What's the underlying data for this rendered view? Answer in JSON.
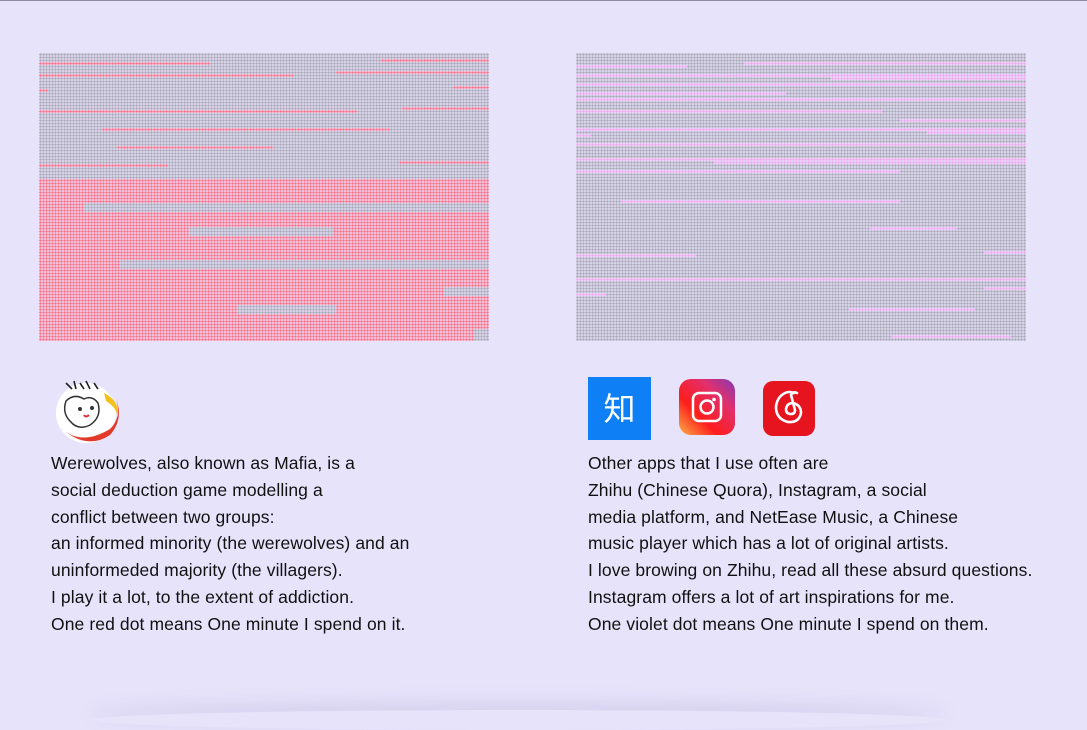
{
  "colors": {
    "background": "#e7e3fb",
    "dot_inactive": "#aba8b8",
    "dot_werewolves": "#ff6e85",
    "dot_other_apps": "#f1a6ee",
    "zhihu_blue": "#0f7ff5",
    "netease_red": "#e6141e"
  },
  "icons": {
    "left": [
      "werewolves-game-logo"
    ],
    "right": [
      "zhihu-icon",
      "instagram-icon",
      "netease-music-icon"
    ],
    "zhihu_glyph": "知"
  },
  "left": {
    "lines": [
      "Werewolves, also known as Mafia, is a",
      "social deduction game modelling a",
      "conflict between two groups:",
      "an informed minority (the werewolves) and an",
      "uninformeded majority (the villagers).",
      "I play it a lot, to the extent of addiction.",
      "One red dot means One minute I spend on it."
    ]
  },
  "right": {
    "lines": [
      "Other apps that I use often are",
      "Zhihu (Chinese Quora), Instagram, a social",
      "media platform, and NetEase Music, a Chinese",
      "music player which has a lot of original artists.",
      "I love browing on Zhihu, read all these absurd questions.",
      "Instagram offers a lot of art inspirations for me.",
      "One violet dot means One minute I spend on them."
    ]
  }
}
